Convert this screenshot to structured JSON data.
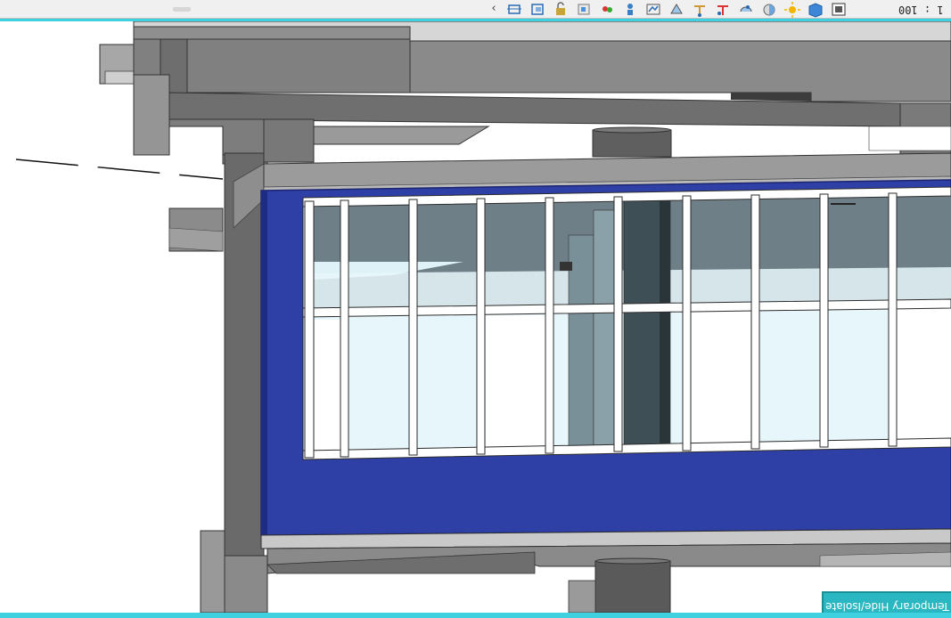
{
  "view_bar": {
    "scale": "1 : 100",
    "overflow_icon": "chevron-left-icon",
    "tools": [
      {
        "name": "crop-region-icon"
      },
      {
        "name": "show-crop-icon"
      },
      {
        "name": "unlock-view-icon"
      },
      {
        "name": "temporary-hide-icon"
      },
      {
        "name": "reveal-hidden-icon"
      },
      {
        "name": "temporary-properties-icon"
      },
      {
        "name": "worksharing-icon"
      },
      {
        "name": "highlight-displacement-icon"
      },
      {
        "name": "reveal-constraints-icon"
      },
      {
        "name": "analytical-model-icon"
      },
      {
        "name": "render-icon"
      },
      {
        "name": "shadows-icon"
      },
      {
        "name": "sun-path-icon"
      },
      {
        "name": "visual-style-icon"
      },
      {
        "name": "detail-level-icon"
      }
    ]
  },
  "mode_banner": {
    "text": "Temporary Hide/Isolate"
  },
  "colors": {
    "viewport_border": "#3fd1e0",
    "banner": "#2ab7c2",
    "curtain_panel": "#2e3fa5",
    "glass": "#e6f6fb",
    "concrete": "#8a8a8a"
  }
}
